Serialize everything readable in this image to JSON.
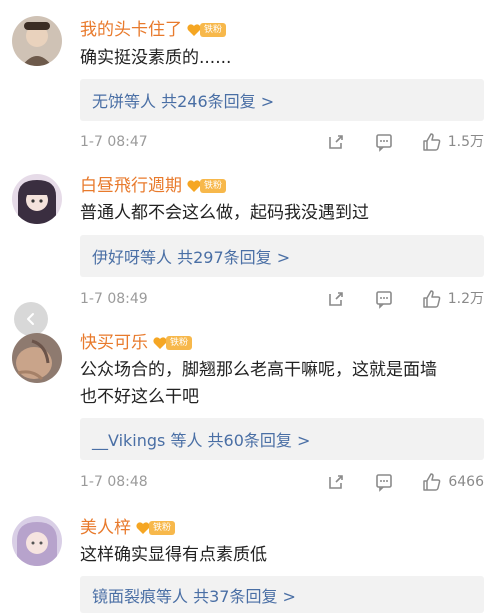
{
  "colors": {
    "name": "#e87a2c",
    "reply_link": "#4a6fa5",
    "meta": "#9b9b9b",
    "badge": "#f7b84b",
    "reply_bg": "#f2f2f2"
  },
  "comments": [
    {
      "username": "我的头卡住了",
      "badge": "铁粉",
      "text": "确实挺没素质的......",
      "reply": "无饼等人 共246条回复 >",
      "time": "1-7 08:47",
      "likes": "1.5万"
    },
    {
      "username": "白昼飛行週期",
      "badge": "铁粉",
      "text": "普通人都不会这么做，起码我没遇到过",
      "reply": "伊好呀等人 共297条回复 >",
      "time": "1-7 08:49",
      "likes": "1.2万"
    },
    {
      "username": "快买可乐",
      "badge": "铁粉",
      "text_line1": "公众场合的，脚翘那么老高干嘛呢，这就是面墙",
      "text_line2": "也不好这么干吧",
      "reply": "__Vikings 等人 共60条回复 >",
      "time": "1-7 08:48",
      "likes": "6466"
    },
    {
      "username": "美人梓",
      "badge": "铁粉",
      "text": "这样确实显得有点素质低",
      "reply": "镜面裂痕等人 共37条回复 >"
    }
  ]
}
